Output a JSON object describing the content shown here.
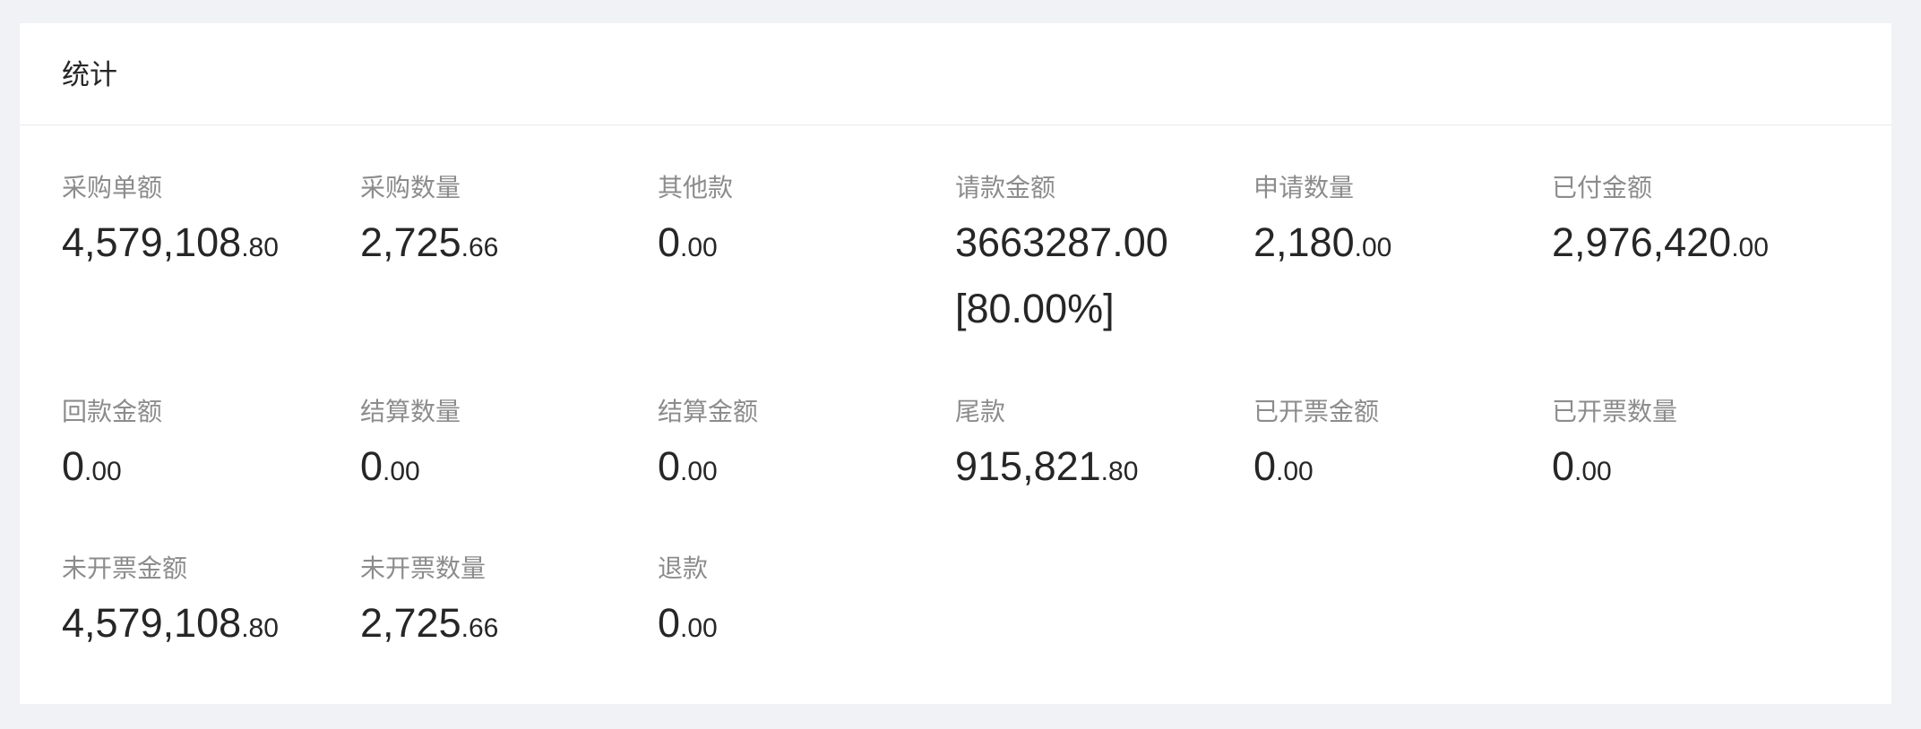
{
  "card": {
    "title": "统计"
  },
  "stats": [
    {
      "label": "采购单额",
      "int": "4,579,108",
      "dec": ".80"
    },
    {
      "label": "采购数量",
      "int": "2,725",
      "dec": ".66"
    },
    {
      "label": "其他款",
      "int": "0",
      "dec": ".00"
    },
    {
      "label": "请款金额",
      "int": "3663287.00",
      "dec": "",
      "extra": "[80.00%]"
    },
    {
      "label": "申请数量",
      "int": "2,180",
      "dec": ".00"
    },
    {
      "label": "已付金额",
      "int": "2,976,420",
      "dec": ".00"
    },
    {
      "label": "回款金额",
      "int": "0",
      "dec": ".00"
    },
    {
      "label": "结算数量",
      "int": "0",
      "dec": ".00"
    },
    {
      "label": "结算金额",
      "int": "0",
      "dec": ".00"
    },
    {
      "label": "尾款",
      "int": "915,821",
      "dec": ".80"
    },
    {
      "label": "已开票金额",
      "int": "0",
      "dec": ".00"
    },
    {
      "label": "已开票数量",
      "int": "0",
      "dec": ".00"
    },
    {
      "label": "未开票金额",
      "int": "4,579,108",
      "dec": ".80"
    },
    {
      "label": "未开票数量",
      "int": "2,725",
      "dec": ".66"
    },
    {
      "label": "退款",
      "int": "0",
      "dec": ".00"
    }
  ]
}
